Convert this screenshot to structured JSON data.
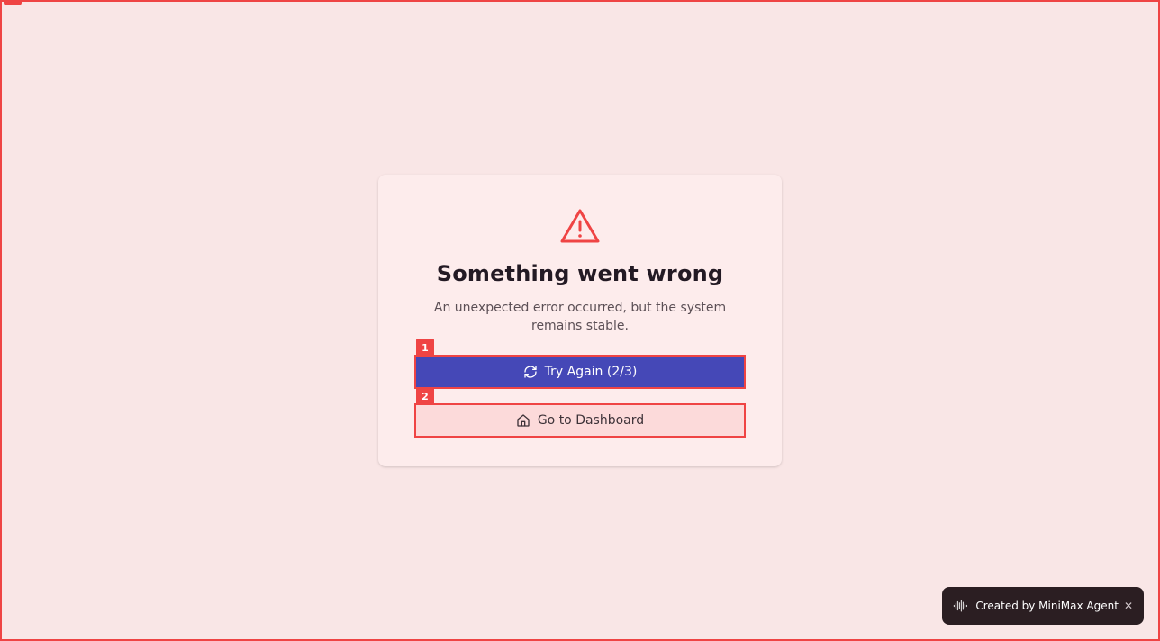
{
  "error": {
    "title": "Something went wrong",
    "message": "An unexpected error occurred, but the system remains stable.",
    "icon": "warning-triangle-icon"
  },
  "actions": {
    "retry_label": "Try Again (2/3)",
    "retry_icon": "refresh-icon",
    "dashboard_label": "Go to Dashboard",
    "dashboard_icon": "home-icon"
  },
  "badges": {
    "retry": "1",
    "dashboard": "2"
  },
  "toast": {
    "text": "Created by MiniMax Agent",
    "close": "✕",
    "icon": "soundwave-icon"
  },
  "colors": {
    "background": "#f9e6e6",
    "card": "#fdecec",
    "accent_red": "#ef4444",
    "primary_button": "#4548b7",
    "secondary_button": "#fcdada",
    "toast_bg": "#2b1e22"
  }
}
